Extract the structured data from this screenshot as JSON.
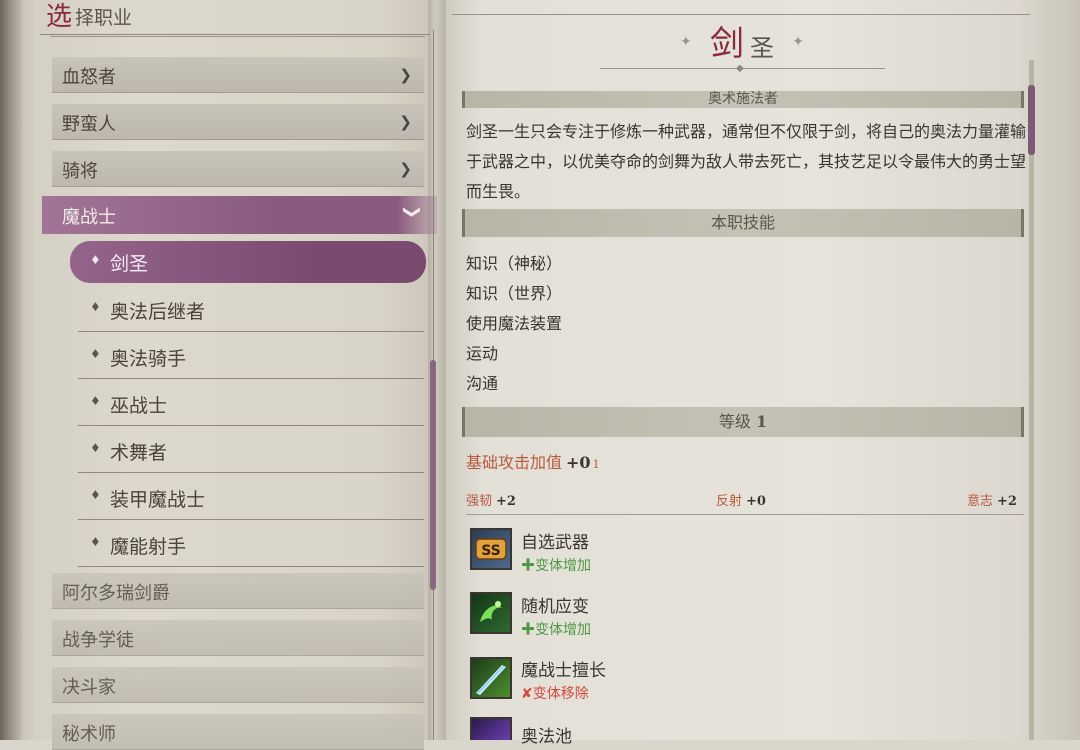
{
  "left_panel": {
    "header_first_char": "选",
    "header_rest": "择职业",
    "classes_top": [
      {
        "label": "血怒者"
      },
      {
        "label": "野蛮人"
      },
      {
        "label": "骑将"
      }
    ],
    "expanded_class": {
      "label": "魔战士"
    },
    "subclasses": [
      {
        "label": "剑圣"
      },
      {
        "label": "奥法后继者"
      },
      {
        "label": "奥法骑手"
      },
      {
        "label": "巫战士"
      },
      {
        "label": "术舞者"
      },
      {
        "label": "装甲魔战士"
      },
      {
        "label": "魔能射手"
      }
    ],
    "classes_bottom": [
      {
        "label": "阿尔多瑞剑爵"
      },
      {
        "label": "战争学徒"
      },
      {
        "label": "决斗家"
      },
      {
        "label": "秘术师"
      }
    ],
    "chevron_glyph": "❯",
    "expanded_glyph": "❯",
    "bullet_glyph": "♦"
  },
  "detail": {
    "title_first": "剑",
    "title_rest": "圣",
    "subtitle_bar": "奥术施法者",
    "description": "剑圣一生只会专注于修炼一种武器，通常但不仅限于剑，将自己的奥法力量灌输于武器之中，以优美夺命的剑舞为敌人带去死亡，其技艺足以令最伟大的勇士望而生畏。",
    "class_skills_header": "本职技能",
    "class_skills": [
      "知识（神秘）",
      "知识（世界）",
      "使用魔法装置",
      "运动",
      "沟通"
    ],
    "level_header_label": "等级",
    "level_header_value": "1",
    "bab_label": "基础攻击加值",
    "bab_value": "+0",
    "bab_sub": "1",
    "saves": [
      {
        "label": "强韧",
        "value": "+2"
      },
      {
        "label": "反射",
        "value": "+0"
      },
      {
        "label": "意志",
        "value": "+2"
      }
    ],
    "features": [
      {
        "name": "自选武器",
        "tag": "变体增加",
        "tag_type": "add",
        "icon": "ss-weapon-icon"
      },
      {
        "name": "随机应变",
        "tag": "变体增加",
        "tag_type": "add",
        "icon": "green-swirl-icon"
      },
      {
        "name": "魔战士擅长",
        "tag": "变体移除",
        "tag_type": "remove",
        "icon": "blade-icon"
      },
      {
        "name": "奥法池",
        "tag": "",
        "tag_type": "",
        "icon": "arcane-pool-icon"
      }
    ],
    "add_glyph": "✚",
    "remove_glyph": "✘"
  },
  "colors": {
    "accent_purple": "#8a5a80",
    "title_red": "#8a2a3a",
    "stat_orange": "#b8593f",
    "add_green": "#4d9a45",
    "remove_red": "#d04a3c"
  }
}
